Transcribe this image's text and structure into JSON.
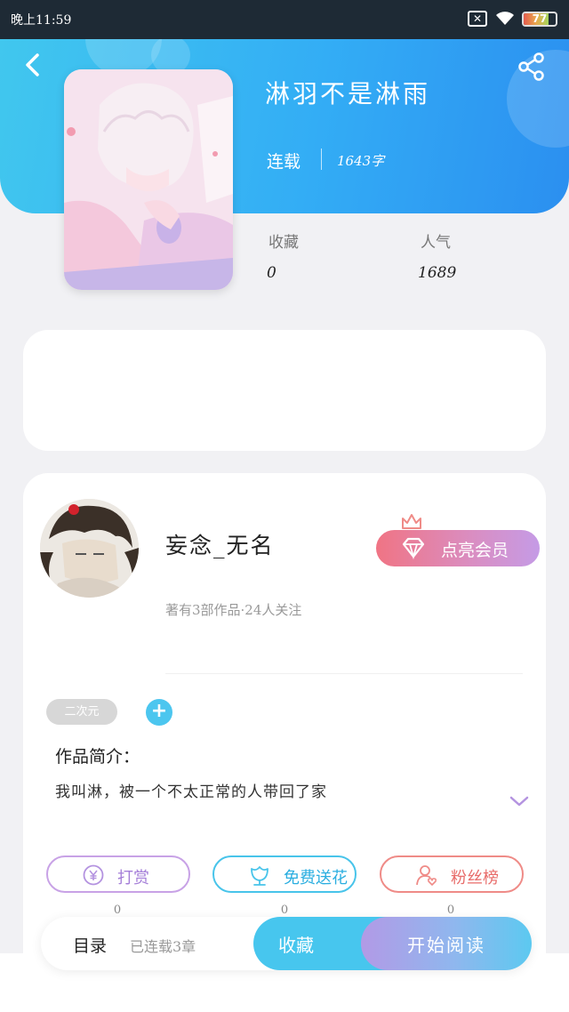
{
  "status_bar": {
    "time": "晚上11:59",
    "sim": "✕",
    "battery": "77",
    "battery_level": 0.77
  },
  "book": {
    "title": "淋羽不是淋雨",
    "status": "连载",
    "word_count": "1643字"
  },
  "stats": [
    {
      "label": "收藏",
      "value": "0"
    },
    {
      "label": "人气",
      "value": "1689"
    }
  ],
  "author": {
    "name": "妄念_无名",
    "meta": "著有3部作品·24人关注",
    "vip_label": "点亮会员"
  },
  "tags": [
    "二次元"
  ],
  "tag_add": "+",
  "intro": {
    "title": "作品简介：",
    "text": "我叫淋，被一个不太正常的人带回了家"
  },
  "actions": [
    {
      "label": "打赏",
      "count": "0",
      "icon": "yen-coin-icon",
      "color": "#a47ed8"
    },
    {
      "label": "免费送花",
      "count": "0",
      "icon": "flower-icon",
      "color": "#2aaee0"
    },
    {
      "label": "粉丝榜",
      "count": "0",
      "icon": "fans-icon",
      "color": "#e86c6a"
    }
  ],
  "bottom_bar": {
    "toc_label": "目录",
    "toc_progress": "已连载3章",
    "collect_label": "收藏",
    "read_label": "开始阅读"
  },
  "colors": {
    "header_start": "#41c7ee",
    "header_end": "#2b8ff0",
    "accent": "#47c6ee",
    "vip": "#f07484"
  }
}
